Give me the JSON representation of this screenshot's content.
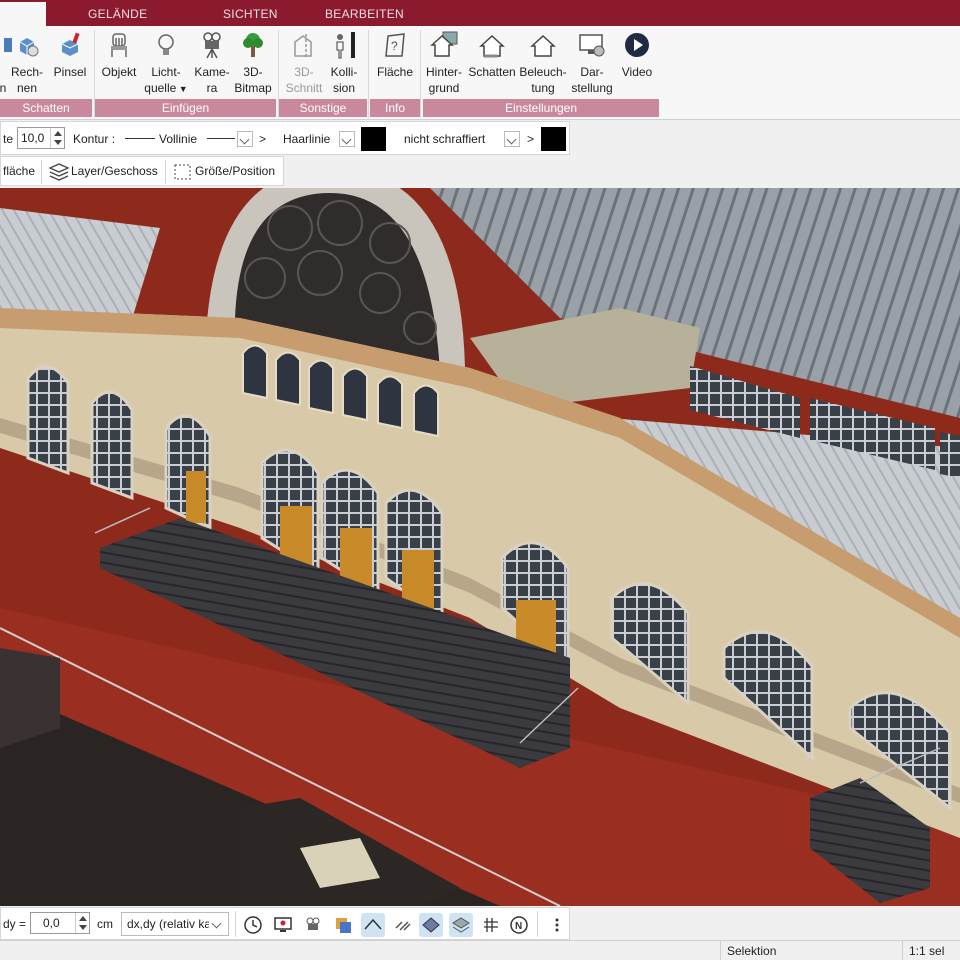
{
  "tabs": [
    {
      "label": ""
    },
    {
      "label": "GELÄNDE"
    },
    {
      "label": "SICHTEN"
    },
    {
      "label": "BEARBEITEN"
    }
  ],
  "ribbon": {
    "buttons": [
      {
        "line1": "",
        "line2": "n",
        "icon": "partial-icon"
      },
      {
        "line1": "Rech-",
        "line2": "nen",
        "icon": "cube-render-icon"
      },
      {
        "line1": "Pinsel",
        "line2": "",
        "icon": "paint-brush-icon"
      },
      {
        "line1": "Objekt",
        "line2": "",
        "icon": "chair-object-icon"
      },
      {
        "line1": "Licht-",
        "line2": "quelle",
        "icon": "lightbulb-icon"
      },
      {
        "line1": "Kame-",
        "line2": "ra",
        "icon": "camera-icon"
      },
      {
        "line1": "3D-",
        "line2": "Bitmap",
        "icon": "tree-icon"
      },
      {
        "line1": "3D-",
        "line2": "Schnitt",
        "icon": "section-cut-icon"
      },
      {
        "line1": "Kolli-",
        "line2": "sion",
        "icon": "collision-person-icon"
      },
      {
        "line1": "Fläche",
        "line2": "",
        "icon": "area-info-icon"
      },
      {
        "line1": "Hinter-",
        "line2": "grund",
        "icon": "background-house-icon"
      },
      {
        "line1": "Schatten",
        "line2": "",
        "icon": "shadow-house-icon"
      },
      {
        "line1": "Beleuch-",
        "line2": "tung",
        "icon": "lighting-house-icon"
      },
      {
        "line1": "Dar-",
        "line2": "stellung",
        "icon": "display-settings-icon"
      },
      {
        "line1": "Video",
        "line2": "",
        "icon": "play-video-icon"
      }
    ],
    "groups": [
      "Schatten",
      "Einfügen",
      "Sonstige",
      "Info",
      "Einstellungen"
    ]
  },
  "properties": {
    "width_label": "te",
    "width_value": "10,0",
    "contour_label": "Kontur :",
    "line_style": "Vollinie",
    "arrow1": ">",
    "hairline": "Haarlinie",
    "hatch": "nicht schraffiert",
    "arrow2": ">",
    "color_fill": "#000000",
    "color_hatch": "#000000"
  },
  "toolbar2": {
    "item1": "fläche",
    "item2": "Layer/Geschoss",
    "item3": "Größe/Position"
  },
  "bottombar": {
    "dy_label": "dy =",
    "dy_value": "0,0",
    "unit": "cm",
    "mode": "dx,dy (relativ ka",
    "icons": [
      "clock-icon",
      "monitor-icon",
      "camera-view-icon",
      "layers-color-icon",
      "roof-icon",
      "hatch-icon",
      "plane-icon",
      "plane-stack-icon",
      "grid-icon",
      "north-icon",
      "more-icon"
    ]
  },
  "status": {
    "mode": "Selektion",
    "selection": "1:1 sel"
  }
}
